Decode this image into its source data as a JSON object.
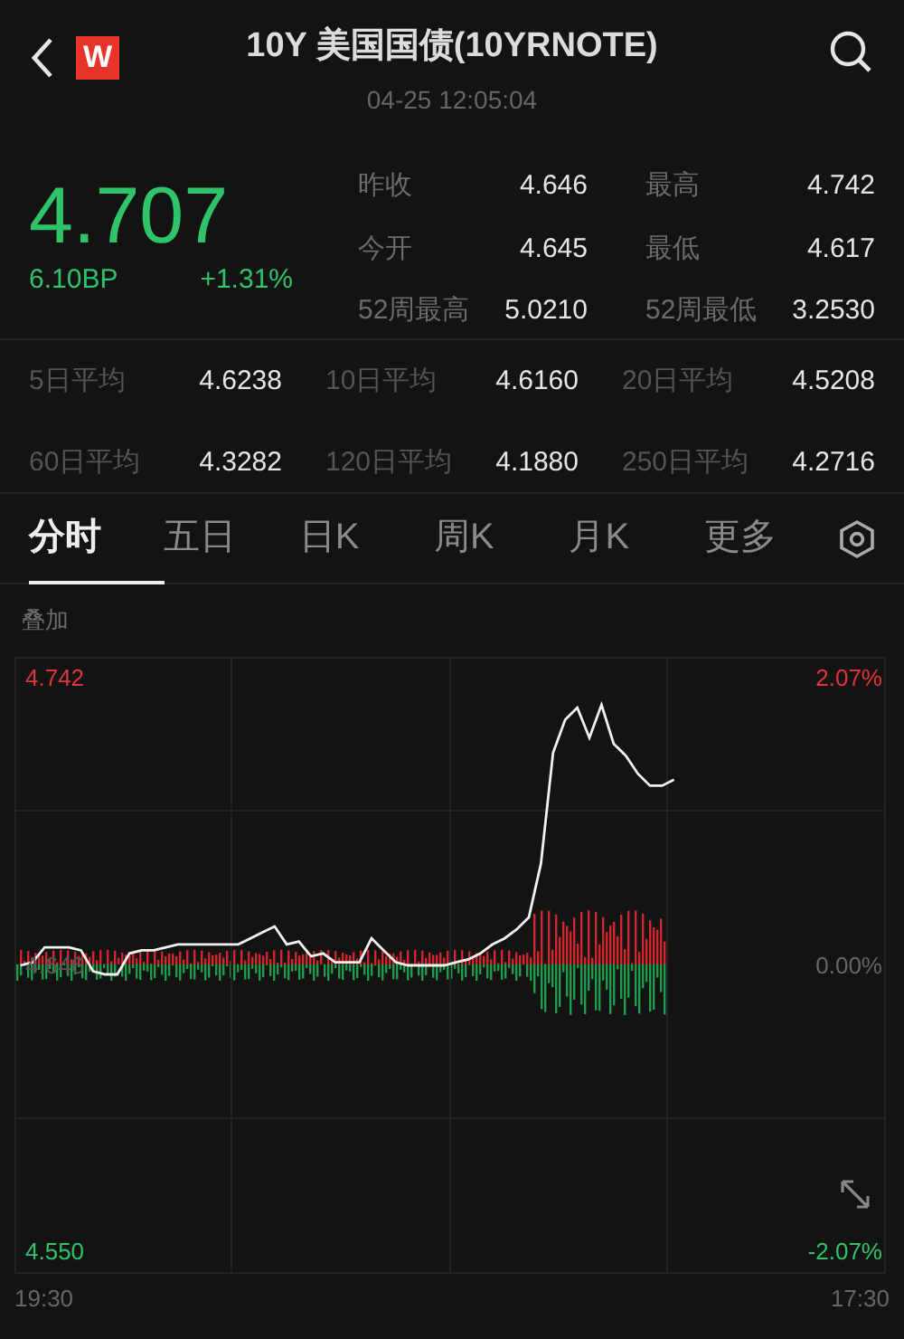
{
  "header": {
    "logo": "W",
    "title": "10Y 美国国债(10YRNOTE)",
    "time": "04-25 12:05:04"
  },
  "quote": {
    "price": "4.707",
    "change": "6.10BP",
    "percent": "+1.31%",
    "stats": [
      {
        "label": "昨收",
        "value": "4.646"
      },
      {
        "label": "最高",
        "value": "4.742"
      },
      {
        "label": "今开",
        "value": "4.645"
      },
      {
        "label": "最低",
        "value": "4.617"
      },
      {
        "label": "52周最高",
        "value": "5.0210"
      },
      {
        "label": "52周最低",
        "value": "3.2530"
      }
    ]
  },
  "averages": [
    {
      "label": "5日平均",
      "value": "4.6238"
    },
    {
      "label": "10日平均",
      "value": "4.6160"
    },
    {
      "label": "20日平均",
      "value": "4.5208"
    },
    {
      "label": "60日平均",
      "value": "4.3282"
    },
    {
      "label": "120日平均",
      "value": "4.1880"
    },
    {
      "label": "250日平均",
      "value": "4.2716"
    }
  ],
  "tabs": [
    {
      "label": "分时",
      "selected": true
    },
    {
      "label": "五日",
      "selected": false
    },
    {
      "label": "日K",
      "selected": false
    },
    {
      "label": "周K",
      "selected": false
    },
    {
      "label": "月K",
      "selected": false
    },
    {
      "label": "更多",
      "selected": false
    }
  ],
  "chart": {
    "overlay": "叠加",
    "high_pct": "2.07%",
    "base_pct": "0.00%",
    "low_pct": "-2.07%",
    "start_time": "19:30",
    "end_time": "17:30",
    "chart_data": {
      "type": "line",
      "categories": [
        null,
        null,
        null,
        null,
        null,
        null,
        null,
        null,
        null,
        null,
        null,
        null,
        null,
        null,
        null,
        null,
        null,
        null,
        null,
        null,
        null,
        null,
        null,
        null,
        null,
        null,
        null,
        null,
        null,
        null,
        null,
        null,
        null,
        null,
        null,
        null,
        null,
        null,
        null,
        null,
        null,
        null,
        null,
        null,
        null,
        null,
        null,
        null,
        null,
        null,
        null,
        null,
        null,
        null,
        null,
        null,
        null,
        null,
        null,
        null,
        null,
        null,
        null,
        null,
        null,
        null,
        null,
        null,
        null,
        null,
        null,
        null
      ],
      "series": [
        {
          "color": "#f2f2f2",
          "values": [
            4.646,
            4.647,
            4.652,
            4.652,
            4.652,
            4.651,
            4.644,
            4.643,
            4.643,
            4.65,
            4.651,
            4.651,
            4.652,
            4.653,
            4.653,
            4.653,
            4.653,
            4.653,
            4.653,
            4.655,
            4.657,
            4.659,
            4.653,
            4.654,
            4.649,
            4.65,
            4.647,
            4.647,
            4.647,
            4.655,
            4.651,
            4.647,
            4.646,
            4.646,
            4.646,
            4.646,
            4.647,
            4.648,
            4.65,
            4.653,
            4.655,
            4.658,
            4.662,
            4.68,
            4.717,
            4.728,
            4.732,
            4.722,
            4.733,
            4.72,
            4.716,
            4.71,
            4.706,
            4.706,
            4.708,
            null,
            null,
            null,
            null,
            null,
            null,
            null,
            null,
            null,
            null,
            null,
            null,
            null,
            null,
            null,
            null,
            null
          ]
        }
      ],
      "ylim": [
        4.543,
        4.749
      ],
      "yticks": [
        {
          "value": 4.742,
          "label": "4.742"
        },
        {
          "value": 4.646,
          "label": "4.646"
        },
        {
          "value": 4.55,
          "label": "4.550"
        }
      ]
    }
  }
}
